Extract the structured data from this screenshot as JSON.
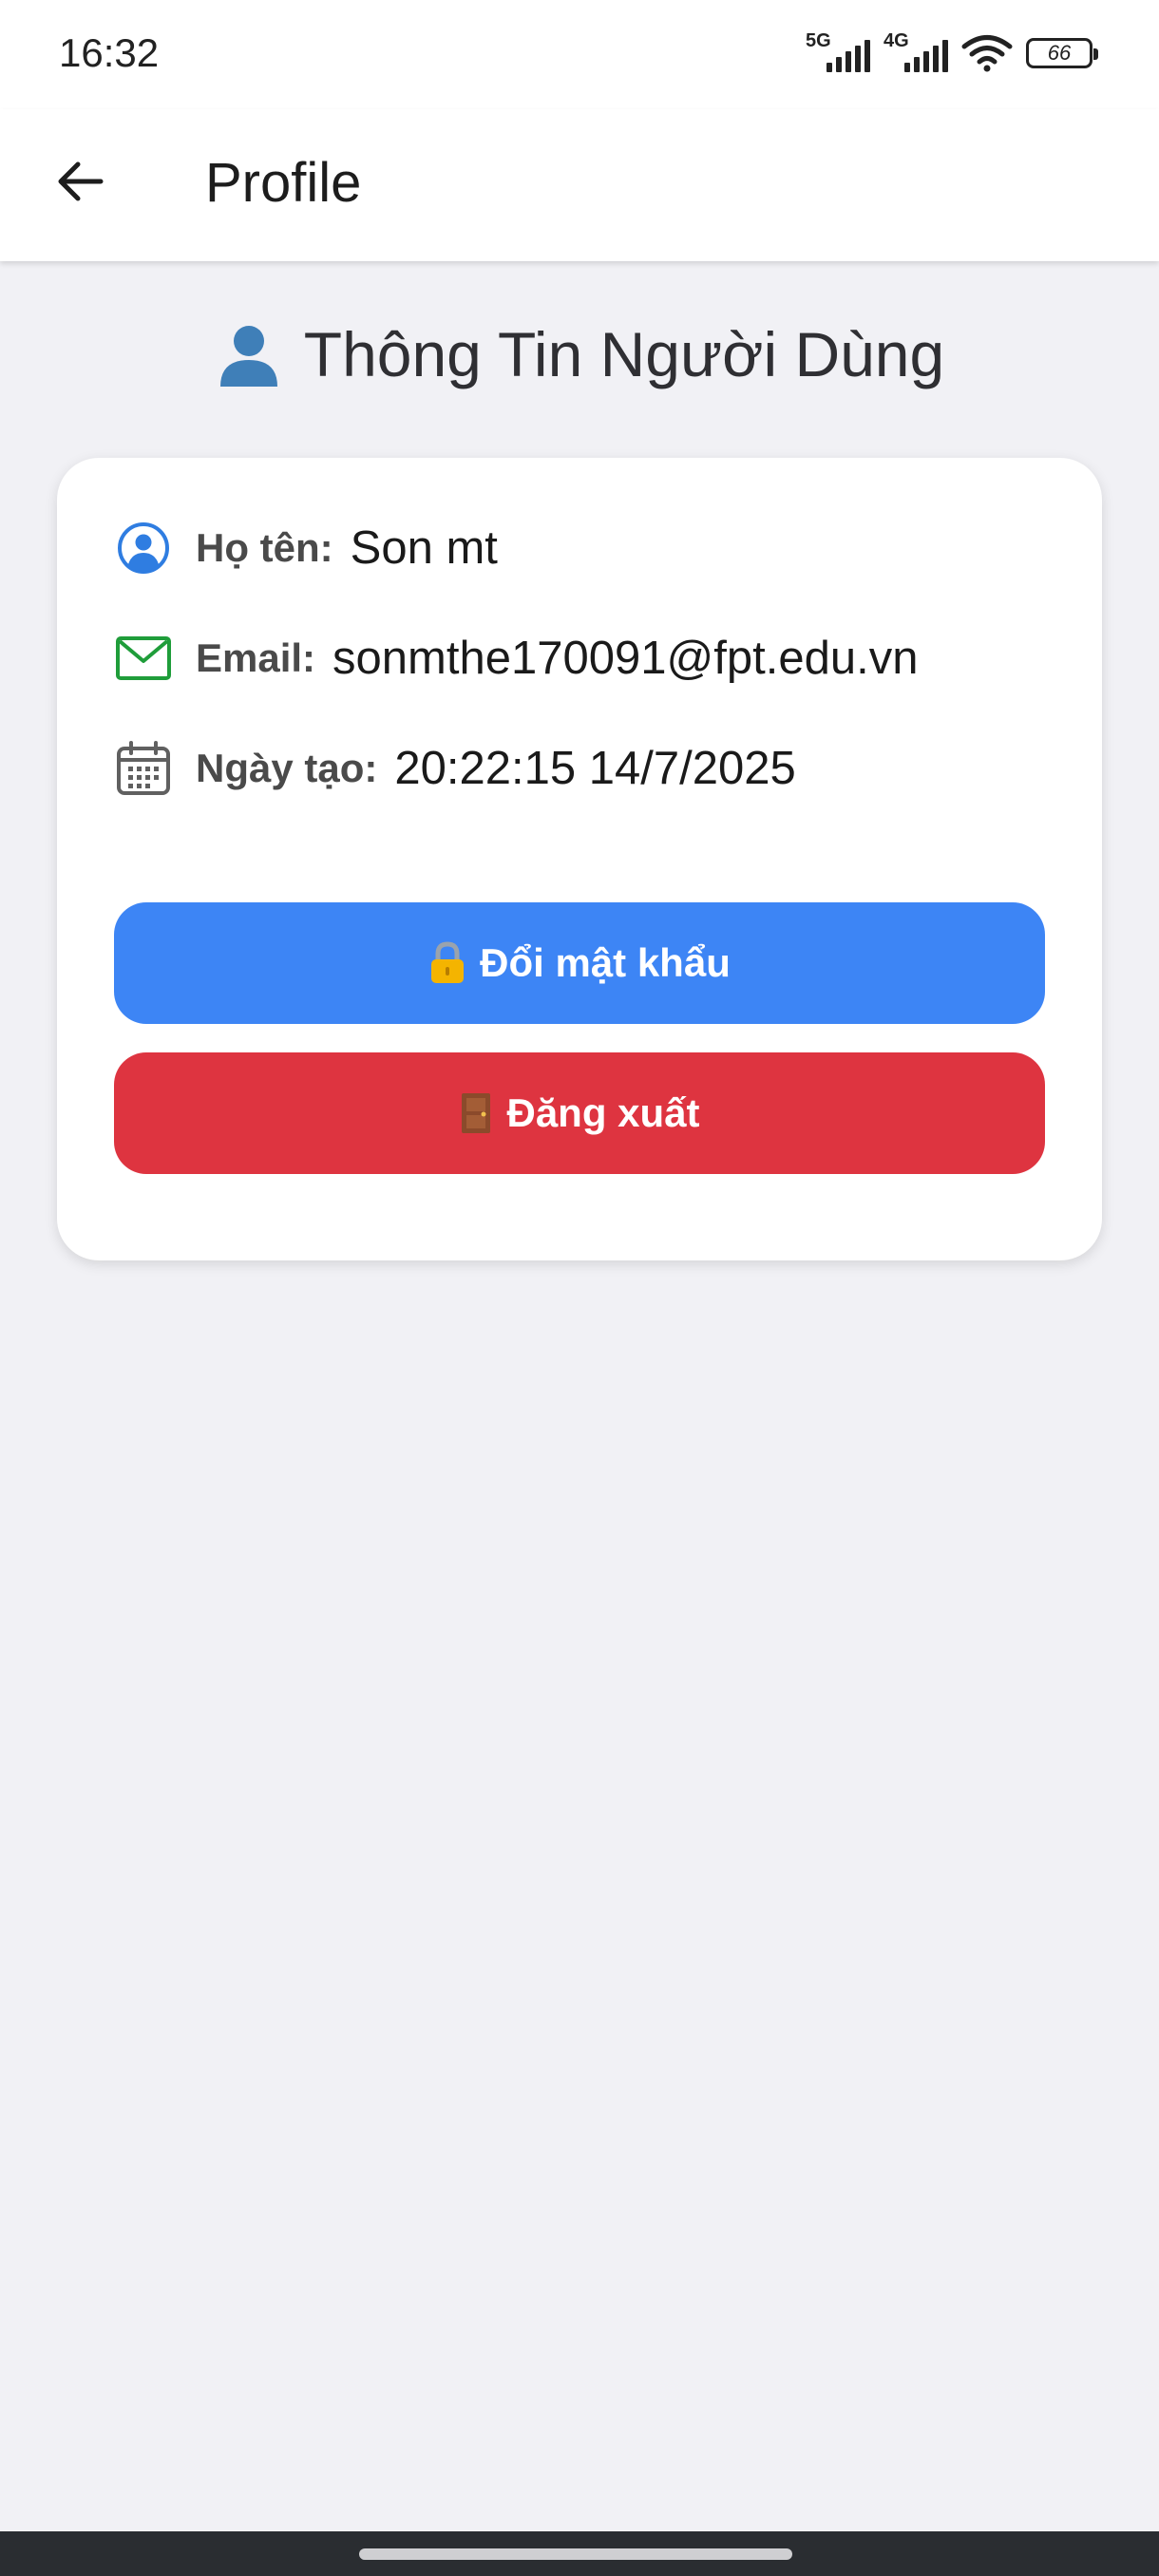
{
  "status_bar": {
    "time": "16:32",
    "network_1": "5G",
    "network_2": "4G",
    "battery": "66",
    "icons": [
      "signal-5g-icon",
      "signal-4g-icon",
      "wifi-icon",
      "battery-icon"
    ]
  },
  "app_bar": {
    "title": "Profile",
    "back_icon": "arrow-left-icon"
  },
  "page": {
    "heading": "Thông Tin Người Dùng",
    "heading_icon": "person-icon"
  },
  "profile": {
    "name_label": "Họ tên:",
    "name_value": "Son mt",
    "email_label": "Email:",
    "email_value": "sonmthe170091@fpt.edu.vn",
    "created_label": "Ngày tạo:",
    "created_value": "20:22:15 14/7/2025"
  },
  "actions": {
    "change_password_label": "Đổi mật khẩu",
    "change_password_icon": "lock-icon",
    "logout_label": "Đăng xuất",
    "logout_icon": "door-icon"
  },
  "colors": {
    "accent_blue": "#3d85f5",
    "danger_red": "#de3440",
    "user_icon_blue": "#2f7de1",
    "mail_icon_green": "#1f9d3a"
  }
}
